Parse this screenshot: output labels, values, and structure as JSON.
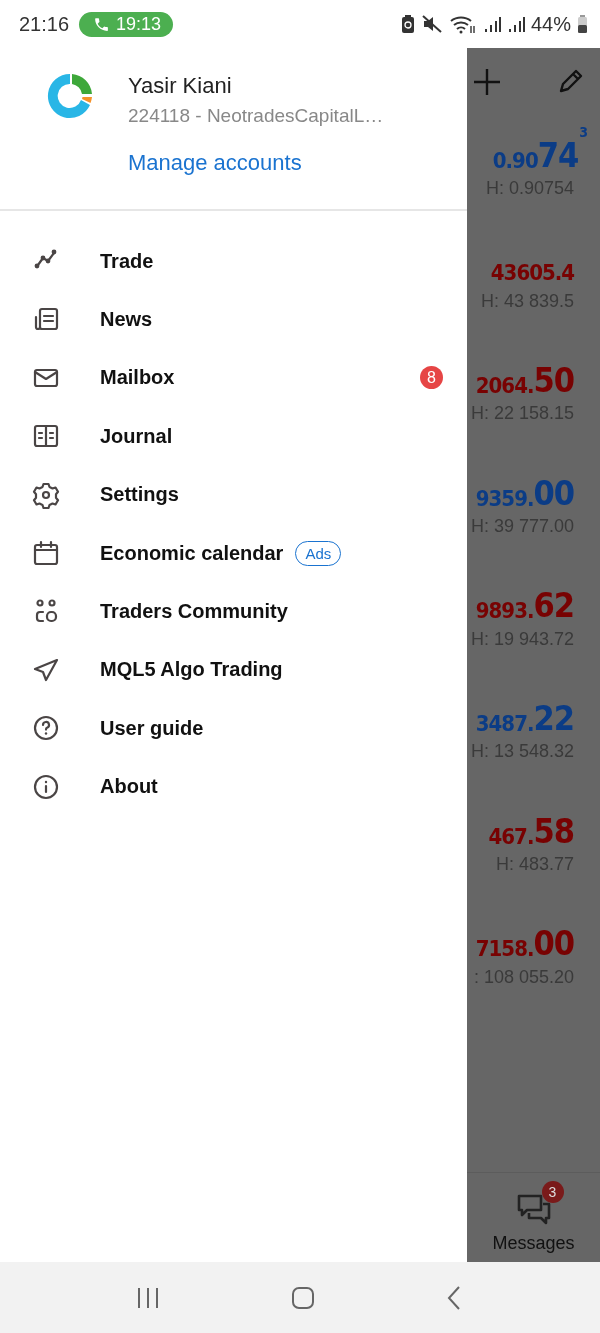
{
  "status_bar": {
    "time": "21:16",
    "call_timer": "19:13",
    "battery": "44%"
  },
  "account": {
    "name": "Yasir Kiani",
    "details": "224118 - NeotradesCapitalL…",
    "manage_link": "Manage accounts"
  },
  "menu": [
    {
      "label": "Trade"
    },
    {
      "label": "News"
    },
    {
      "label": "Mailbox",
      "badge": "8"
    },
    {
      "label": "Journal"
    },
    {
      "label": "Settings"
    },
    {
      "label": "Economic calendar",
      "tag": "Ads"
    },
    {
      "label": "Traders Community"
    },
    {
      "label": "MQL5 Algo Trading"
    },
    {
      "label": "User guide"
    },
    {
      "label": "About"
    }
  ],
  "quotes": [
    {
      "price_small": "0.90",
      "price_big": "74",
      "price_sup": "3",
      "high": "H: 0.90754",
      "color": "#0b3c86"
    },
    {
      "price_small": "43605.4",
      "high": "H: 43 839.5",
      "color": "#780202"
    },
    {
      "price_small": "2064.",
      "price_big": "50",
      "high": "H: 22 158.15",
      "color": "#780202"
    },
    {
      "price_small": "9359.",
      "price_big": "00",
      "high": "H: 39 777.00",
      "color": "#0b3c86"
    },
    {
      "price_small": "9893.",
      "price_big": "62",
      "high": "H: 19 943.72",
      "color": "#780202"
    },
    {
      "price_small": "3487.",
      "price_big": "22",
      "high": "H: 13 548.32",
      "color": "#0b3c86"
    },
    {
      "price_small": "467.",
      "price_big": "58",
      "high": "H: 483.77",
      "color": "#780202"
    },
    {
      "price_small": "7158.",
      "price_big": "00",
      "high": ": 108 055.20",
      "color": "#780202"
    }
  ],
  "bottom_tab": {
    "label": "Messages",
    "badge": "3"
  }
}
